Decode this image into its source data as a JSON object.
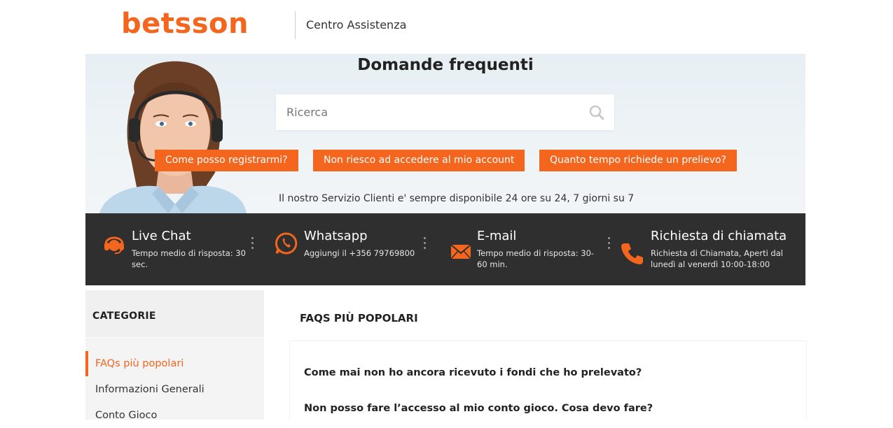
{
  "header": {
    "logo": "betsson",
    "title": "Centro Assistenza"
  },
  "hero": {
    "title": "Domande frequenti",
    "search_placeholder": "Ricerca",
    "quick_links": [
      "Come posso registrarmi?",
      "Non riesco ad accedere al mio account",
      "Quanto tempo richiede un prelievo?"
    ],
    "note": "Il nostro Servizio Clienti e' sempre disponibile 24 ore su 24, 7 giorni su 7"
  },
  "contacts": [
    {
      "title": "Live Chat",
      "sub": "Tempo medio di risposta: 30 sec.",
      "icon": "headset-icon"
    },
    {
      "title": "Whatsapp",
      "sub": "Aggiungi il +356 79769800",
      "icon": "whatsapp-icon"
    },
    {
      "title": "E-mail",
      "sub": "Tempo medio di risposta: 30-60 min.",
      "icon": "envelope-icon"
    },
    {
      "title": "Richiesta di chiamata",
      "sub": "Richiesta di Chiamata, Aperti dal lunedì al venerdì 10:00-18:00",
      "icon": "phone-icon"
    }
  ],
  "sidebar": {
    "heading": "CATEGORIE",
    "items": [
      {
        "label": "FAQs più popolari",
        "active": true
      },
      {
        "label": "Informazioni Generali",
        "active": false
      },
      {
        "label": "Conto Gioco",
        "active": false
      }
    ]
  },
  "main": {
    "title": "FAQS PIÙ POPOLARI",
    "faqs": [
      "Come mai non ho ancora ricevuto i fondi che ho prelevato?",
      "Non posso fare l’accesso al mio conto gioco. Cosa devo fare?"
    ]
  },
  "colors": {
    "accent": "#f4651d",
    "contact_bar": "#2f2f2f",
    "sidebar_bg": "#f4f4f4"
  }
}
